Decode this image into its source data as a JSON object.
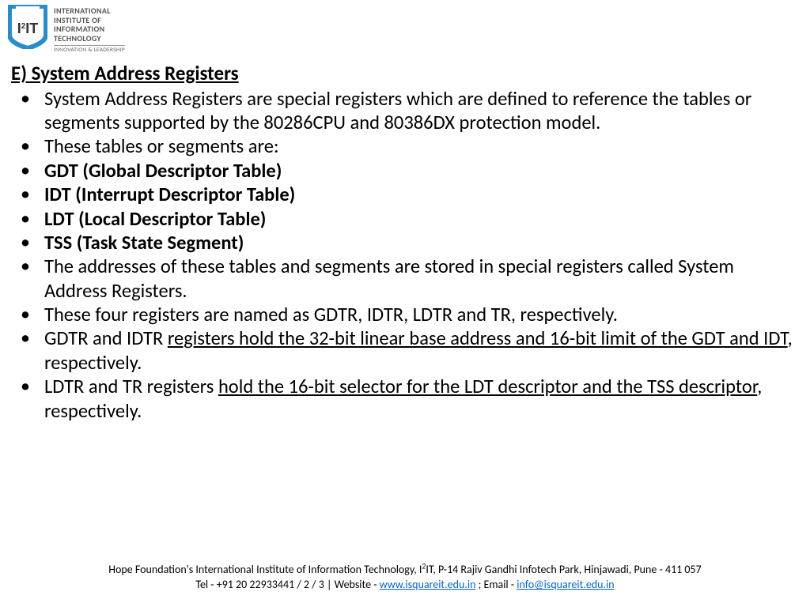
{
  "logo": {
    "line1": "INTERNATIONAL",
    "line2": "INSTITUTE OF",
    "line3": "INFORMATION",
    "line4": "TECHNOLOGY",
    "tagline": "INNOVATION & LEADERSHIP",
    "shield_text_main": "I",
    "shield_text_sup": "2",
    "shield_text_suffix": "IT"
  },
  "section": {
    "heading": "E)  System Address Registers",
    "bullets": [
      {
        "type": "plain",
        "text": "System Address Registers are special registers which are defined to reference the tables or segments supported by the 80286CPU and 80386DX protection model."
      },
      {
        "type": "plain",
        "text": "These tables or segments are:"
      },
      {
        "type": "bold",
        "text": "GDT (Global Descriptor Table)"
      },
      {
        "type": "bold",
        "text": "IDT (Interrupt Descriptor Table)"
      },
      {
        "type": "bold",
        "text": "LDT (Local Descriptor Table)"
      },
      {
        "type": "bold",
        "text": "TSS (Task State Segment)"
      },
      {
        "type": "plain",
        "text": "The addresses of these tables and segments are stored in special registers called System Address Registers."
      },
      {
        "type": "plain",
        "text": " These four registers are named as GDTR, IDTR, LDTR and TR, respectively."
      },
      {
        "type": "mixed",
        "prefix": "GDTR and IDTR ",
        "underlined": "registers hold the 32-bit linear base address and 16-bit limit of the GDT and IDT",
        "suffix": ", respectively."
      },
      {
        "type": "mixed",
        "prefix": "LDTR and TR registers ",
        "underlined": "hold the 16-bit selector for the LDT descriptor and the TSS descriptor",
        "suffix": ", respectively."
      }
    ]
  },
  "footer": {
    "line1_prefix": "Hope Foundation's International Institute of Information Technology, I",
    "line1_sup": "2",
    "line1_suffix": "IT, P-14 Rajiv Gandhi Infotech Park, Hinjawadi, Pune - 411 057",
    "tel": "Tel - +91 20 22933441 / 2 / 3",
    "sep": "   |   ",
    "website_label": "Website - ",
    "website_link": "www.isquareit.edu.in",
    "email_sep": " ; Email - ",
    "email_link": "info@isquareit.edu.in"
  }
}
